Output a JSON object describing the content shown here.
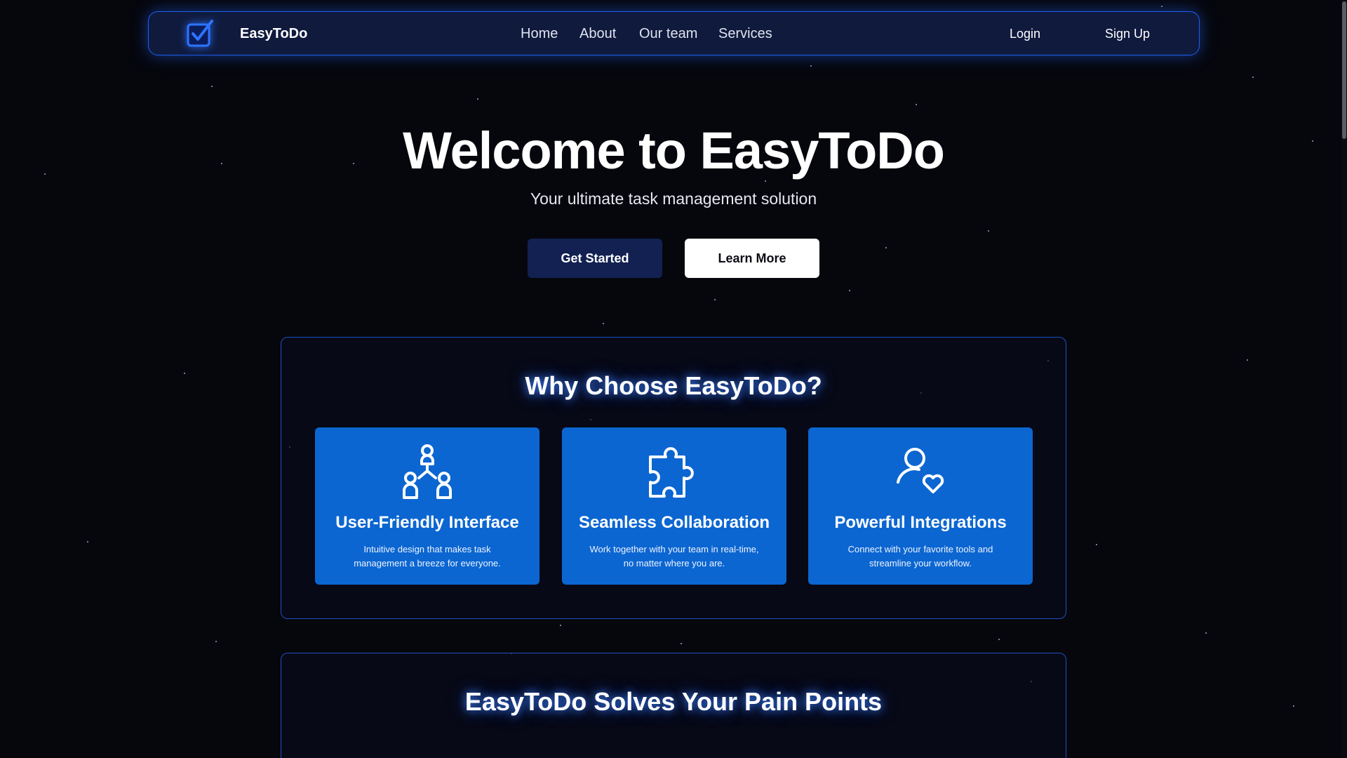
{
  "brand": {
    "name": "EasyToDo",
    "logo_icon": "checkbox-icon",
    "accent": "#1f5ff0"
  },
  "nav": {
    "links": [
      {
        "label": "Home"
      },
      {
        "label": "About"
      },
      {
        "label": "Our team"
      },
      {
        "label": "Services"
      }
    ],
    "login_label": "Login",
    "signup_label": "Sign Up"
  },
  "hero": {
    "title": "Welcome to EasyToDo",
    "subtitle": "Your ultimate task management solution",
    "primary_button": "Get Started",
    "secondary_button": "Learn More"
  },
  "why": {
    "title": "Why Choose EasyToDo?",
    "card_color": "#0b66d1",
    "cards": [
      {
        "icon": "team-hierarchy-icon",
        "title": "User-Friendly Interface",
        "desc_line1": "Intuitive design that makes task",
        "desc_line2": "management a breeze for everyone."
      },
      {
        "icon": "puzzle-piece-icon",
        "title": "Seamless Collaboration",
        "desc_line1": "Work together with your team in real-time,",
        "desc_line2": "no matter where you are."
      },
      {
        "icon": "user-heart-icon",
        "title": "Powerful Integrations",
        "desc_line1": "Connect with your favorite tools and",
        "desc_line2": "streamline your workflow."
      }
    ]
  },
  "pain_points": {
    "title": "EasyToDo Solves Your Pain Points"
  }
}
